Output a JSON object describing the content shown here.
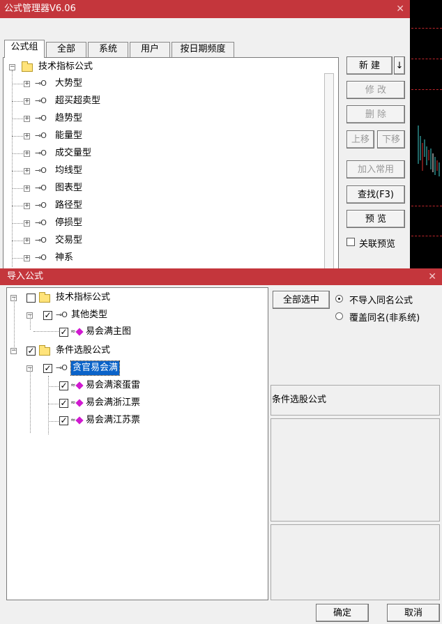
{
  "manager": {
    "title": "公式管理器V6.06",
    "tabs": [
      {
        "label": "公式组",
        "active": true
      },
      {
        "label": "全部"
      },
      {
        "label": "系统"
      },
      {
        "label": "用户"
      },
      {
        "label": "按日期频度"
      }
    ],
    "tree": {
      "root": "技术指标公式",
      "items": [
        "大势型",
        "超买超卖型",
        "趋势型",
        "能量型",
        "成交量型",
        "均线型",
        "图表型",
        "路径型",
        "停损型",
        "交易型",
        "神系"
      ]
    },
    "buttons": {
      "new": "新 建",
      "new_arrow": "↓",
      "modify": "修 改",
      "delete": "删 除",
      "move_up": "上移",
      "move_down": "下移",
      "add_common": "加入常用",
      "find": "查找(F3)",
      "preview": "预 览"
    },
    "linked_preview": {
      "label": "关联预览",
      "checked": false
    }
  },
  "import": {
    "title": "导入公式",
    "tree": [
      {
        "label": "技术指标公式",
        "checked": false,
        "children": [
          {
            "label": "其他类型",
            "checked": true,
            "children": [
              {
                "label": "易会满主图",
                "checked": true
              }
            ]
          }
        ]
      },
      {
        "label": "条件选股公式",
        "checked": true,
        "children": [
          {
            "label": "贪官易会满",
            "checked": true,
            "selected": true,
            "children": [
              {
                "label": "易会满滚蛋雷",
                "checked": true
              },
              {
                "label": "易会满浙江票",
                "checked": true
              },
              {
                "label": "易会满江苏票",
                "checked": true
              }
            ]
          }
        ]
      }
    ],
    "select_all": "全部选中",
    "options": [
      {
        "label": "不导入同名公式",
        "selected": true
      },
      {
        "label": "覆盖同名(非系统)",
        "selected": false
      }
    ],
    "info_text": "条件选股公式",
    "ok": "确定",
    "cancel": "取消"
  },
  "colors": {
    "title_bar": "#c4363c",
    "selection": "#0a63c9",
    "gem": "#d01ad0",
    "chart_red": "#c0262c"
  }
}
